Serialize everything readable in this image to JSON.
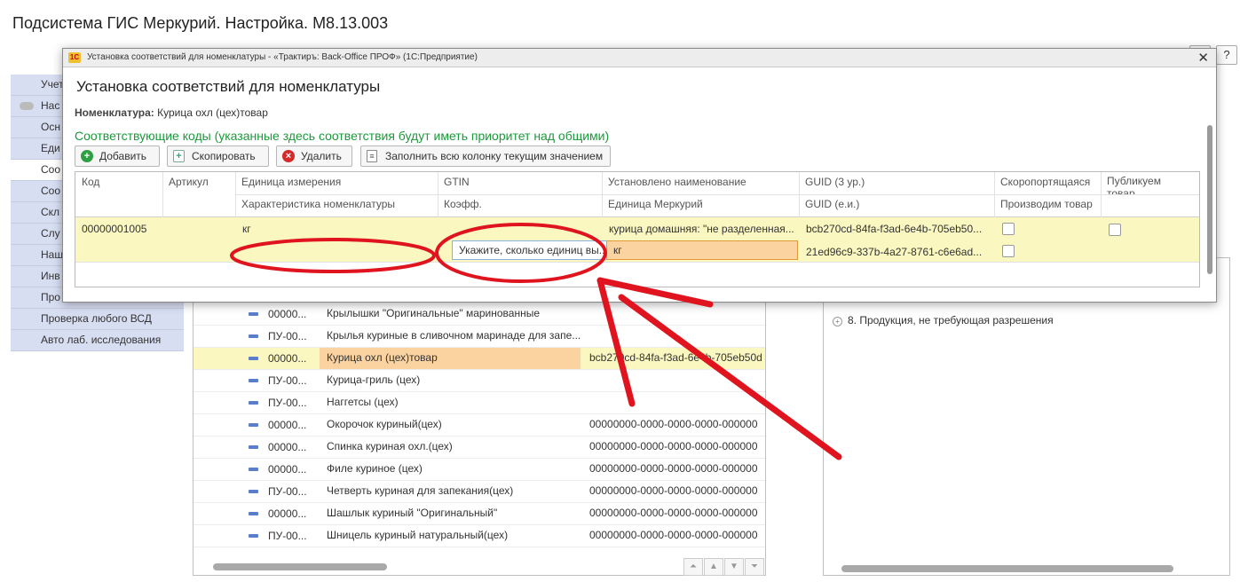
{
  "page": {
    "title": "Подсистема ГИС Меркурий. Настройка. М8.13.003",
    "top_buttons": [
      "⋮",
      "?"
    ]
  },
  "nav": {
    "items": [
      {
        "label": "Учет",
        "active": false,
        "toggle": false
      },
      {
        "label": "Нас",
        "active": false,
        "toggle": true
      },
      {
        "label": "Осн",
        "active": false,
        "toggle": false
      },
      {
        "label": "Еди",
        "active": false,
        "toggle": false
      },
      {
        "label": "Соо",
        "active": true,
        "toggle": false
      },
      {
        "label": "Соо",
        "active": false,
        "toggle": false
      },
      {
        "label": "Скл",
        "active": false,
        "toggle": false
      },
      {
        "label": "Слу",
        "active": false,
        "toggle": false
      },
      {
        "label": "Наш",
        "active": false,
        "toggle": false
      },
      {
        "label": "Инв",
        "active": false,
        "toggle": false
      },
      {
        "label": "Про",
        "active": false,
        "toggle": false
      },
      {
        "label": "Проверка любого ВСД",
        "active": false,
        "toggle": false
      },
      {
        "label": "Авто лаб. исследования",
        "active": false,
        "toggle": false
      }
    ]
  },
  "background_list": {
    "rows": [
      {
        "code": "00000...",
        "name": "Крылышки \"Оригинальные\" маринованные",
        "guid": "",
        "selected": false
      },
      {
        "code": "ПУ-00...",
        "name": "Крылья куриные в сливочном маринаде для запе...",
        "guid": "",
        "selected": false
      },
      {
        "code": "00000...",
        "name": "Курица охл (цех)товар",
        "guid": "bcb270cd-84fa-f3ad-6e4b-705eb50d",
        "selected": true
      },
      {
        "code": "ПУ-00...",
        "name": "Курица-гриль (цех)",
        "guid": "",
        "selected": false
      },
      {
        "code": "ПУ-00...",
        "name": "Наггетсы (цех)",
        "guid": "",
        "selected": false
      },
      {
        "code": "00000...",
        "name": "Окорочок куриный(цех)",
        "guid": "00000000-0000-0000-0000-000000",
        "selected": false
      },
      {
        "code": "00000...",
        "name": "Спинка куриная охл.(цех)",
        "guid": "00000000-0000-0000-0000-000000",
        "selected": false
      },
      {
        "code": "00000...",
        "name": "Филе куриное (цех)",
        "guid": "00000000-0000-0000-0000-000000",
        "selected": false
      },
      {
        "code": "ПУ-00...",
        "name": "Четверть куриная для запекания(цех)",
        "guid": "00000000-0000-0000-0000-000000",
        "selected": false
      },
      {
        "code": "00000...",
        "name": "Шашлык куриный \"Оригинальный\"",
        "guid": "00000000-0000-0000-0000-000000",
        "selected": false
      },
      {
        "code": "ПУ-00...",
        "name": "Шницель куриный натуральный(цех)",
        "guid": "00000000-0000-0000-0000-000000",
        "selected": false
      }
    ]
  },
  "right_panel": {
    "tree_item": "8. Продукция, не требующая разрешения"
  },
  "dialog": {
    "window_title": "Установка соответствий для номенклатуры - «Трактиръ: Back-Office ПРОФ» (1С:Предприятие)",
    "logo": "1С",
    "heading": "Установка соответствий для номенклатуры",
    "field_label": "Номенклатура:",
    "field_value": "Курица охл (цех)товар",
    "green_note": "Соответствующие коды (указанные здесь соответствия будут иметь приоритет над общими)",
    "toolbar": {
      "add": "Добавить",
      "copy": "Скопировать",
      "delete": "Удалить",
      "fill_column": "Заполнить всю колонку текущим значением"
    },
    "grid": {
      "headers_top": [
        "Код",
        "Артикул",
        "Единица измерения",
        "GTIN",
        "Установлено наименование",
        "GUID (3 ур.)",
        "Скоропортящаяся",
        "Публикуем товар"
      ],
      "headers_bottom": [
        "Характеристика номенклатуры",
        "Коэфф.",
        "Единица Меркурий",
        "GUID (е.и.)",
        "Производим товар"
      ],
      "row": {
        "code": "00000001005",
        "unit": "кг",
        "name_set": "курица домашняя: \"не разделенная...",
        "guid3": "bcb270cd-84fa-f3ad-6e4b-705eb50...",
        "coef_hint": "Укажите, сколько единиц вы...",
        "mercury_unit": "кг",
        "guid_unit": "21ed96c9-337b-4a27-8761-c6e6ad..."
      }
    }
  },
  "annotation_color": "#e0141e"
}
